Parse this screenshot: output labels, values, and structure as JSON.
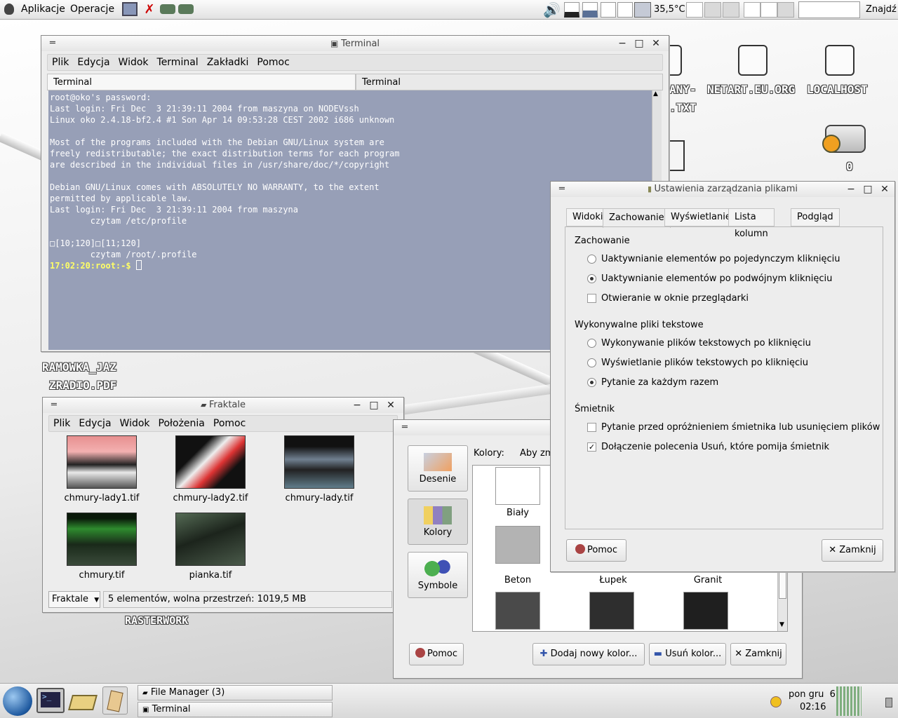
{
  "top_panel": {
    "menu_apps": "Aplikacje",
    "menu_actions": "Operacje",
    "temperature": "35,5°C",
    "search_button": "Znajdź"
  },
  "desktop": {
    "icons": [
      {
        "label": "ANY-",
        "label2": ".TXT"
      },
      {
        "label": "NETART.EU.ORG"
      },
      {
        "label": "LOCALHOST"
      },
      {
        "label": "0"
      }
    ],
    "ramowka": {
      "line1": "RAMOWKA_JAZ",
      "line2": "ZRADIO.PDF"
    },
    "rasterwork": "RASTERWORK"
  },
  "terminal": {
    "title": "Terminal",
    "menu": [
      "Plik",
      "Edycja",
      "Widok",
      "Terminal",
      "Zakładki",
      "Pomoc"
    ],
    "tabs": [
      "Terminal",
      "Terminal"
    ],
    "lines": [
      "root@oko's password:",
      "Last login: Fri Dec  3 21:39:11 2004 from maszyna on NODEVssh",
      "Linux oko 2.4.18-bf2.4 #1 Son Apr 14 09:53:28 CEST 2002 i686 unknown",
      "",
      "Most of the programs included with the Debian GNU/Linux system are",
      "freely redistributable; the exact distribution terms for each program",
      "are described in the individual files in /usr/share/doc/*/copyright",
      "",
      "Debian GNU/Linux comes with ABSOLUTELY NO WARRANTY, to the extent",
      "permitted by applicable law.",
      "Last login: Fri Dec  3 21:39:11 2004 from maszyna",
      "        czytam /etc/profile",
      "",
      "□[10;120]□[11;120]",
      "        czytam /root/.profile"
    ],
    "prompt": "17:02:20:root:-$ "
  },
  "fraktale": {
    "title": "Fraktale",
    "menu": [
      "Plik",
      "Edycja",
      "Widok",
      "Położenia",
      "Pomoc"
    ],
    "files": [
      "chmury-lady1.tif",
      "chmury-lady2.tif",
      "chmury-lady.tif",
      "chmury.tif",
      "pianka.tif"
    ],
    "location": "Fraktale",
    "status": "5 elementów, wolna przestrzeń: 1019,5 MB"
  },
  "colors_dialog": {
    "side_buttons": [
      "Desenie",
      "Kolory",
      "Symbole"
    ],
    "header_label": "Kolory:",
    "header_hint": "Aby zm",
    "swatches": [
      {
        "name": "Biały",
        "color": "#ffffff"
      },
      {
        "name": "Beton",
        "color": "#b3b3b3"
      },
      {
        "name": "Łupek",
        "color": "#2e2e2e"
      },
      {
        "name": "Granit",
        "color": "#1f1f1f"
      }
    ],
    "bottom_row_colors": [
      "#4a4a4a",
      "#2e2e2e",
      "#1f1f1f"
    ],
    "help_button": "Pomoc",
    "add_button": "Dodaj nowy kolor...",
    "remove_button": "Usuń kolor...",
    "close_button": "Zamknij"
  },
  "prefs_dialog": {
    "title": "Ustawienia zarządzania plikami",
    "tabs": [
      "Widoki",
      "Zachowanie",
      "Wyświetlanie",
      "Lista kolumn",
      "Podgląd"
    ],
    "section_behavior": "Zachowanie",
    "opt_single": "Uaktywnianie elementów po pojedynczym kliknięciu",
    "opt_double": "Uaktywnianie elementów po podwójnym kliknięciu",
    "opt_browser": "Otwieranie w oknie przeglądarki",
    "section_exec": "Wykonywalne pliki tekstowe",
    "opt_run": "Wykonywanie plików tekstowych po kliknięciu",
    "opt_view": "Wyświetlanie plików tekstowych po kliknięciu",
    "opt_ask": "Pytanie za każdym razem",
    "section_trash": "Śmietnik",
    "opt_trash_ask": "Pytanie przed opróżnieniem śmietnika lub usunięciem plików",
    "opt_trash_delete": "Dołączenie polecenia Usuń, które pomija śmietnik",
    "help_button": "Pomoc",
    "close_button": "Zamknij"
  },
  "bottom_panel": {
    "tasks": [
      "File Manager (3)",
      "Terminal"
    ],
    "clock_day": "pon gru  6",
    "clock_time": "02:16"
  }
}
